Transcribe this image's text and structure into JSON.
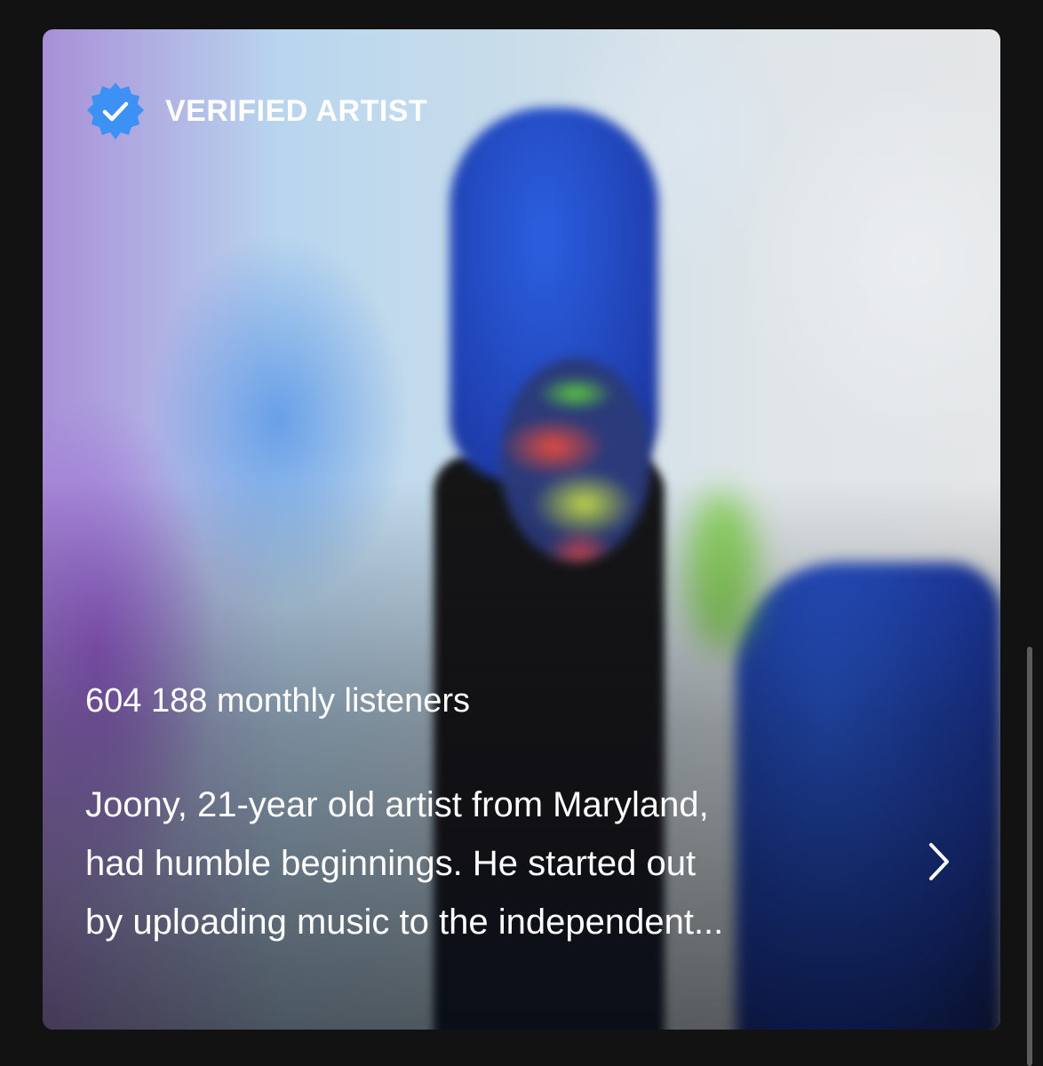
{
  "badge": {
    "icon": "verified-check-icon",
    "label": "VERIFIED ARTIST",
    "color": "#3d91f4"
  },
  "stats": {
    "monthly_listeners": "604 188 monthly listeners"
  },
  "bio": {
    "lines": [
      "Joony, 21-year old artist from Maryland,",
      "had humble beginnings. He started out",
      "by uploading music to the independent..."
    ],
    "expand_icon": "chevron-right-icon"
  },
  "colors": {
    "background": "#121212",
    "text": "#ffffff"
  }
}
